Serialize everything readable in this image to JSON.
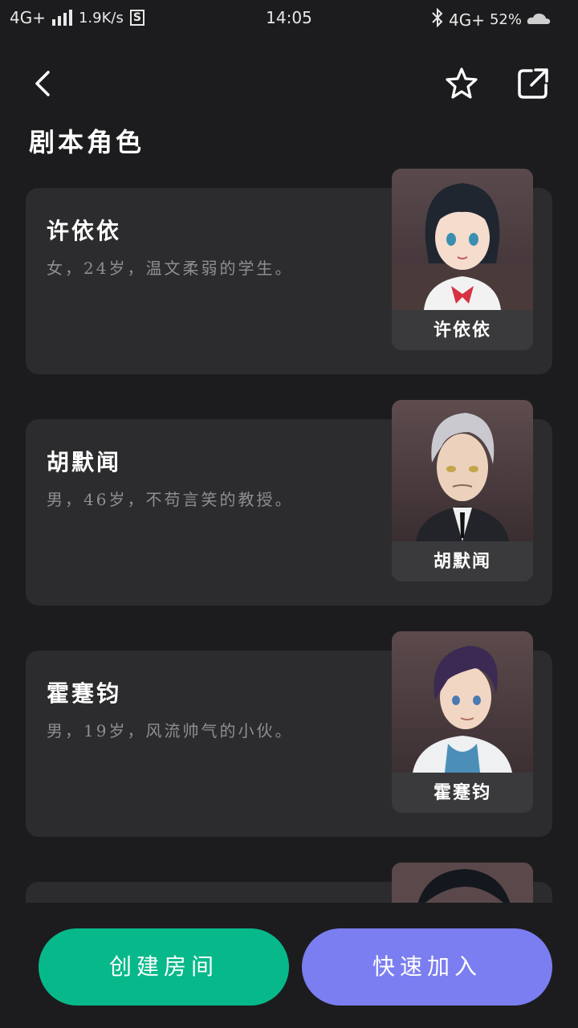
{
  "status_bar": {
    "network_left": "4G+",
    "speed": "1.9K/s",
    "s_badge": "S",
    "time": "14:05",
    "network_right": "4G+",
    "battery": "52%"
  },
  "header": {
    "title": "剧本角色",
    "icons": [
      "back-icon",
      "star-icon",
      "share-icon"
    ]
  },
  "roles": [
    {
      "name": "许依依",
      "desc": "女，24岁，温文柔弱的学生。",
      "portrait_label": "许依依"
    },
    {
      "name": "胡默闻",
      "desc": "男，46岁，不苟言笑的教授。",
      "portrait_label": "胡默闻"
    },
    {
      "name": "霍蹇钧",
      "desc": "男，19岁，风流帅气的小伙。",
      "portrait_label": "霍蹇钧"
    },
    {
      "name": "",
      "desc": "",
      "portrait_label": ""
    }
  ],
  "actions": {
    "create_room": "创建房间",
    "quick_join": "快速加入"
  },
  "colors": {
    "background": "#1c1c1e",
    "card": "#2c2c2e",
    "create_button": "#07b98a",
    "join_button": "#7b7ef0"
  }
}
